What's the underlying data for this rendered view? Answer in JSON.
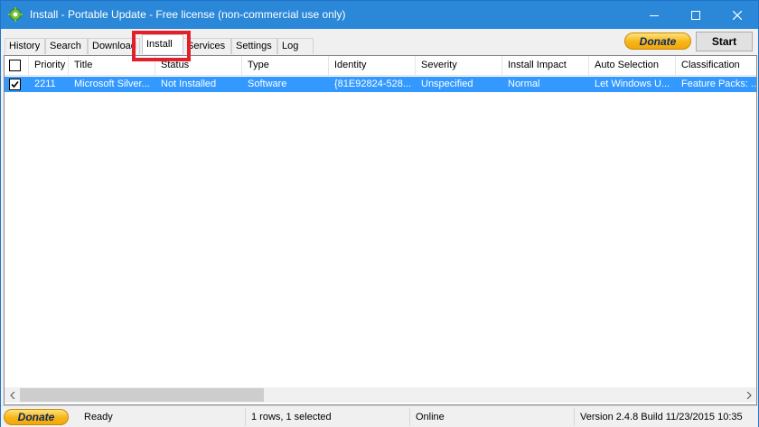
{
  "window": {
    "title": "Install - Portable Update  - Free license (non-commercial use only)"
  },
  "tabs": [
    {
      "label": "History"
    },
    {
      "label": "Search"
    },
    {
      "label": "Download"
    },
    {
      "label": "Install"
    },
    {
      "label": "Services"
    },
    {
      "label": "Settings"
    },
    {
      "label": "Log"
    }
  ],
  "active_tab": "Install",
  "toolbar": {
    "donate_label": "Donate",
    "start_label": "Start"
  },
  "table": {
    "columns": [
      "Priority",
      "Title",
      "Status",
      "Type",
      "Identity",
      "Severity",
      "Install Impact",
      "Auto Selection",
      "Classification"
    ],
    "rows": [
      {
        "checked": true,
        "selected": true,
        "priority": "2211",
        "title": "Microsoft Silver...",
        "status": "Not Installed",
        "type": "Software",
        "identity": "{81E92824-528...",
        "severity": "Unspecified",
        "install_impact": "Normal",
        "auto_selection": "Let Windows U...",
        "classification": "Feature Packs: ..."
      }
    ]
  },
  "statusbar": {
    "donate_label": "Donate",
    "state": "Ready",
    "selection": "1 rows, 1 selected",
    "connection": "Online",
    "version": "Version 2.4.8 Build 11/23/2015 10:35"
  },
  "colors": {
    "titlebar": "#2b88d8",
    "selection": "#3399ff",
    "highlight": "#e3202a",
    "donate": "#f7b518"
  },
  "icons": [
    "app-gear-icon",
    "minimize-icon",
    "maximize-icon",
    "close-icon",
    "checkbox-icon",
    "scroll-left-icon",
    "scroll-right-icon"
  ]
}
